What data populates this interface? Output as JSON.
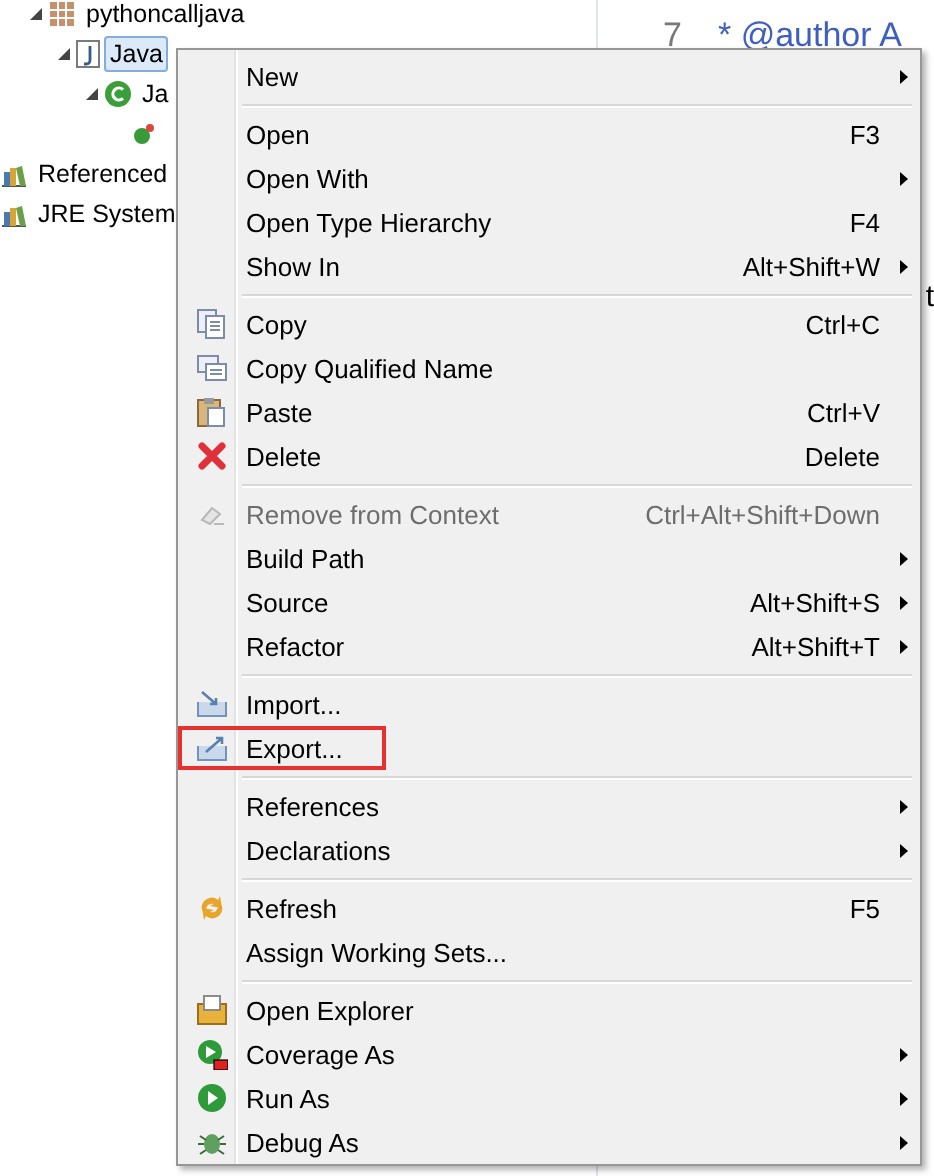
{
  "tree": [
    {
      "kind": "project",
      "label": "pythoncalljava",
      "expanded": true,
      "selected": false,
      "children": [
        {
          "kind": "file",
          "label": "Java",
          "selected": true,
          "expanded": true,
          "children": [
            {
              "kind": "class",
              "label": "Ja",
              "selected": false,
              "expanded": true,
              "children": [
                {
                  "kind": "method"
                }
              ]
            }
          ]
        }
      ]
    },
    {
      "kind": "library",
      "label": "Referenced",
      "selected": false
    },
    {
      "kind": "library",
      "label": "JRE System",
      "selected": false
    }
  ],
  "editor": {
    "line_number": "7",
    "comment": "* @author A",
    "fragments": [
      "t"
    ]
  },
  "context_menu": [
    {
      "kind": "item",
      "label": "New",
      "submenu": true,
      "disabled": false,
      "highlighted": false
    },
    {
      "kind": "separator"
    },
    {
      "kind": "item",
      "label": "Open",
      "shortcut": "F3",
      "submenu": false,
      "disabled": false,
      "highlighted": false
    },
    {
      "kind": "item",
      "label": "Open With",
      "submenu": true,
      "disabled": false,
      "highlighted": false
    },
    {
      "kind": "item",
      "label": "Open Type Hierarchy",
      "shortcut": "F4",
      "submenu": false,
      "disabled": false,
      "highlighted": false
    },
    {
      "kind": "item",
      "label": "Show In",
      "shortcut": "Alt+Shift+W",
      "submenu": true,
      "disabled": false,
      "highlighted": false
    },
    {
      "kind": "separator"
    },
    {
      "kind": "item",
      "label": "Copy",
      "shortcut": "Ctrl+C",
      "submenu": false,
      "disabled": false,
      "highlighted": false
    },
    {
      "kind": "item",
      "label": "Copy Qualified Name",
      "submenu": false,
      "disabled": false,
      "highlighted": false
    },
    {
      "kind": "item",
      "label": "Paste",
      "shortcut": "Ctrl+V",
      "submenu": false,
      "disabled": false,
      "highlighted": false
    },
    {
      "kind": "item",
      "label": "Delete",
      "shortcut": "Delete",
      "submenu": false,
      "disabled": false,
      "highlighted": false
    },
    {
      "kind": "separator"
    },
    {
      "kind": "item",
      "label": "Remove from Context",
      "shortcut": "Ctrl+Alt+Shift+Down",
      "submenu": false,
      "disabled": true,
      "highlighted": false
    },
    {
      "kind": "item",
      "label": "Build Path",
      "submenu": true,
      "disabled": false,
      "highlighted": false
    },
    {
      "kind": "item",
      "label": "Source",
      "shortcut": "Alt+Shift+S",
      "submenu": true,
      "disabled": false,
      "highlighted": false
    },
    {
      "kind": "item",
      "label": "Refactor",
      "shortcut": "Alt+Shift+T",
      "submenu": true,
      "disabled": false,
      "highlighted": false
    },
    {
      "kind": "separator"
    },
    {
      "kind": "item",
      "label": "Import...",
      "submenu": false,
      "disabled": false,
      "highlighted": false
    },
    {
      "kind": "item",
      "label": "Export...",
      "submenu": false,
      "disabled": false,
      "highlighted": true
    },
    {
      "kind": "separator"
    },
    {
      "kind": "item",
      "label": "References",
      "submenu": true,
      "disabled": false,
      "highlighted": false
    },
    {
      "kind": "item",
      "label": "Declarations",
      "submenu": true,
      "disabled": false,
      "highlighted": false
    },
    {
      "kind": "separator"
    },
    {
      "kind": "item",
      "label": "Refresh",
      "shortcut": "F5",
      "submenu": false,
      "disabled": false,
      "highlighted": false
    },
    {
      "kind": "item",
      "label": "Assign Working Sets...",
      "submenu": false,
      "disabled": false,
      "highlighted": false
    },
    {
      "kind": "separator"
    },
    {
      "kind": "item",
      "label": "Open Explorer",
      "submenu": false,
      "disabled": false,
      "highlighted": false
    },
    {
      "kind": "item",
      "label": "Coverage As",
      "submenu": true,
      "disabled": false,
      "highlighted": false
    },
    {
      "kind": "item",
      "label": "Run As",
      "submenu": true,
      "disabled": false,
      "highlighted": false
    },
    {
      "kind": "item",
      "label": "Debug As",
      "submenu": true,
      "disabled": false,
      "highlighted": false
    }
  ]
}
